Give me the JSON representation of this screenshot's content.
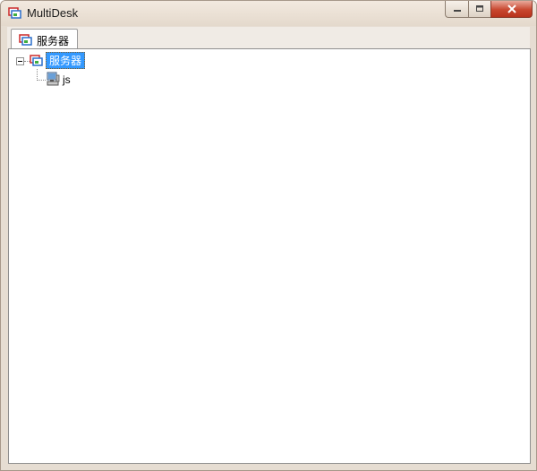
{
  "window": {
    "title": "MultiDesk",
    "controls": {
      "minimize_icon": "minimize-icon",
      "maximize_icon": "maximize-icon",
      "close_icon": "close-icon"
    }
  },
  "tabs": [
    {
      "label": "服务器",
      "icon": "server-group-icon",
      "active": true
    }
  ],
  "tree": {
    "root": {
      "label": "服务器",
      "icon": "server-group-icon",
      "expanded": true,
      "selected": true
    },
    "children": [
      {
        "label": "js",
        "icon": "computer-icon"
      }
    ]
  },
  "colors": {
    "selection": "#3399ff",
    "close_button": "#c8472f"
  }
}
